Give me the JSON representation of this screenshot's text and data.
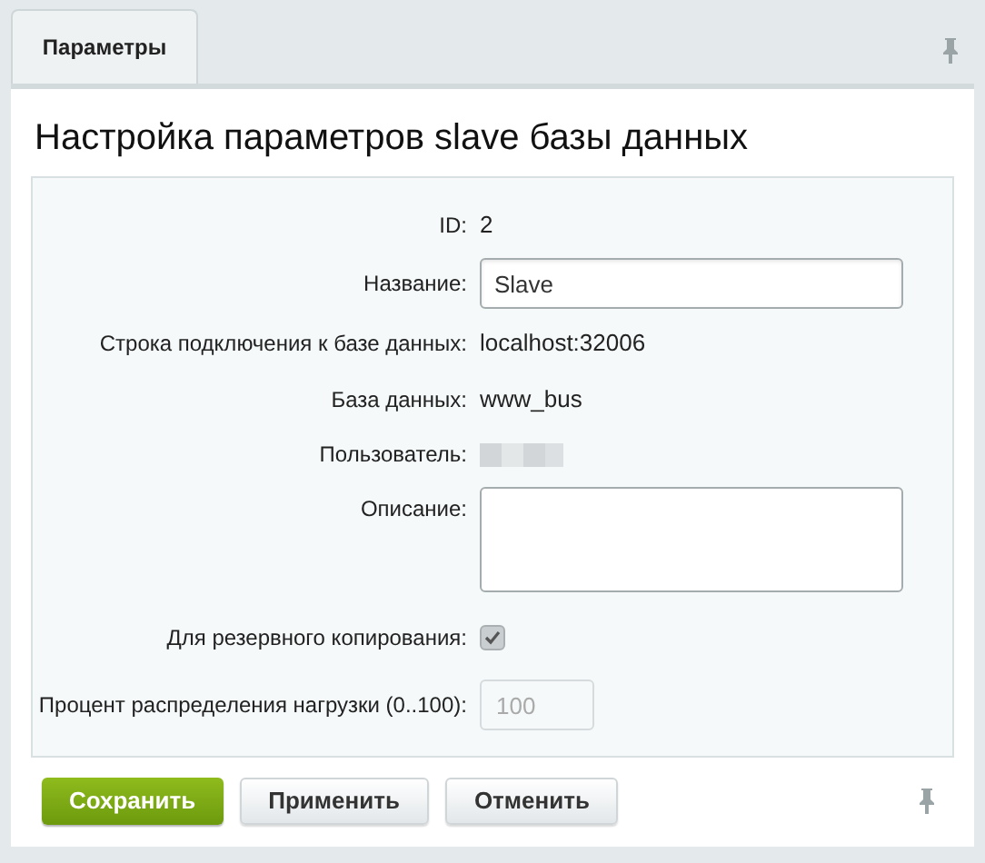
{
  "tabs": [
    {
      "label": "Параметры",
      "selected": true
    }
  ],
  "title": "Настройка параметров slave базы данных",
  "fields": [
    {
      "kind": "text",
      "label": "ID:",
      "value": "2"
    },
    {
      "kind": "input",
      "label": "Название:",
      "value": "Slave"
    },
    {
      "kind": "text",
      "label": "Строка подключения к базе данных:",
      "value": "localhost:32006"
    },
    {
      "kind": "text",
      "label": "База данных:",
      "value": "www_bus"
    },
    {
      "kind": "redacted",
      "label": "Пользователь:"
    },
    {
      "kind": "textarea",
      "label": "Описание:"
    },
    {
      "kind": "checkbox",
      "label": "Для резервного копирования:",
      "checked": true
    },
    {
      "kind": "input",
      "label": "Процент распределения нагрузки (0..100):",
      "placeholder": "100",
      "disabled": true
    }
  ],
  "buttons": [
    {
      "label": "Сохранить",
      "kind": "primary"
    },
    {
      "label": "Применить",
      "kind": "secondary"
    },
    {
      "label": "Отменить",
      "kind": "secondary"
    }
  ]
}
